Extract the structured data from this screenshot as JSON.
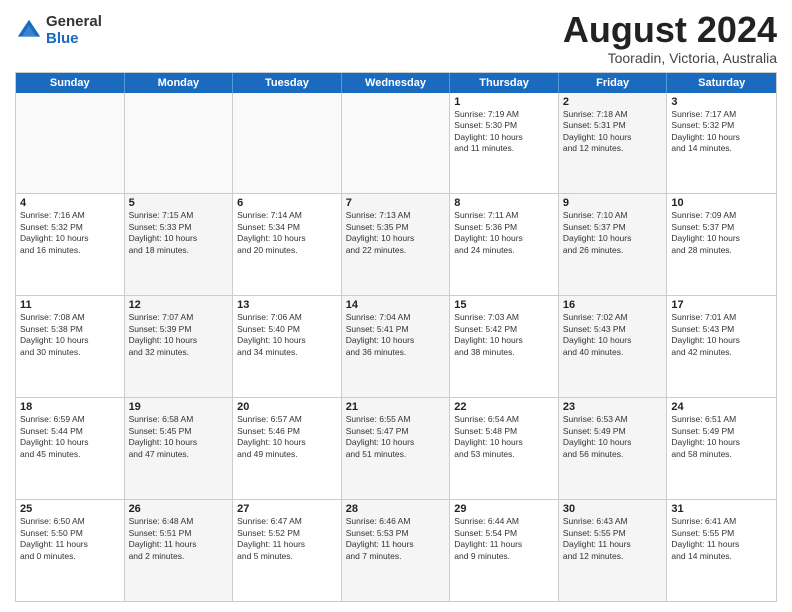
{
  "logo": {
    "general": "General",
    "blue": "Blue"
  },
  "title": "August 2024",
  "location": "Tooradin, Victoria, Australia",
  "header_days": [
    "Sunday",
    "Monday",
    "Tuesday",
    "Wednesday",
    "Thursday",
    "Friday",
    "Saturday"
  ],
  "rows": [
    [
      {
        "day": "",
        "text": "",
        "empty": true
      },
      {
        "day": "",
        "text": "",
        "empty": true
      },
      {
        "day": "",
        "text": "",
        "empty": true
      },
      {
        "day": "",
        "text": "",
        "empty": true
      },
      {
        "day": "1",
        "text": "Sunrise: 7:19 AM\nSunset: 5:30 PM\nDaylight: 10 hours\nand 11 minutes."
      },
      {
        "day": "2",
        "text": "Sunrise: 7:18 AM\nSunset: 5:31 PM\nDaylight: 10 hours\nand 12 minutes.",
        "alt": true
      },
      {
        "day": "3",
        "text": "Sunrise: 7:17 AM\nSunset: 5:32 PM\nDaylight: 10 hours\nand 14 minutes."
      }
    ],
    [
      {
        "day": "4",
        "text": "Sunrise: 7:16 AM\nSunset: 5:32 PM\nDaylight: 10 hours\nand 16 minutes."
      },
      {
        "day": "5",
        "text": "Sunrise: 7:15 AM\nSunset: 5:33 PM\nDaylight: 10 hours\nand 18 minutes.",
        "alt": true
      },
      {
        "day": "6",
        "text": "Sunrise: 7:14 AM\nSunset: 5:34 PM\nDaylight: 10 hours\nand 20 minutes."
      },
      {
        "day": "7",
        "text": "Sunrise: 7:13 AM\nSunset: 5:35 PM\nDaylight: 10 hours\nand 22 minutes.",
        "alt": true
      },
      {
        "day": "8",
        "text": "Sunrise: 7:11 AM\nSunset: 5:36 PM\nDaylight: 10 hours\nand 24 minutes."
      },
      {
        "day": "9",
        "text": "Sunrise: 7:10 AM\nSunset: 5:37 PM\nDaylight: 10 hours\nand 26 minutes.",
        "alt": true
      },
      {
        "day": "10",
        "text": "Sunrise: 7:09 AM\nSunset: 5:37 PM\nDaylight: 10 hours\nand 28 minutes."
      }
    ],
    [
      {
        "day": "11",
        "text": "Sunrise: 7:08 AM\nSunset: 5:38 PM\nDaylight: 10 hours\nand 30 minutes."
      },
      {
        "day": "12",
        "text": "Sunrise: 7:07 AM\nSunset: 5:39 PM\nDaylight: 10 hours\nand 32 minutes.",
        "alt": true
      },
      {
        "day": "13",
        "text": "Sunrise: 7:06 AM\nSunset: 5:40 PM\nDaylight: 10 hours\nand 34 minutes."
      },
      {
        "day": "14",
        "text": "Sunrise: 7:04 AM\nSunset: 5:41 PM\nDaylight: 10 hours\nand 36 minutes.",
        "alt": true
      },
      {
        "day": "15",
        "text": "Sunrise: 7:03 AM\nSunset: 5:42 PM\nDaylight: 10 hours\nand 38 minutes."
      },
      {
        "day": "16",
        "text": "Sunrise: 7:02 AM\nSunset: 5:43 PM\nDaylight: 10 hours\nand 40 minutes.",
        "alt": true
      },
      {
        "day": "17",
        "text": "Sunrise: 7:01 AM\nSunset: 5:43 PM\nDaylight: 10 hours\nand 42 minutes."
      }
    ],
    [
      {
        "day": "18",
        "text": "Sunrise: 6:59 AM\nSunset: 5:44 PM\nDaylight: 10 hours\nand 45 minutes."
      },
      {
        "day": "19",
        "text": "Sunrise: 6:58 AM\nSunset: 5:45 PM\nDaylight: 10 hours\nand 47 minutes.",
        "alt": true
      },
      {
        "day": "20",
        "text": "Sunrise: 6:57 AM\nSunset: 5:46 PM\nDaylight: 10 hours\nand 49 minutes."
      },
      {
        "day": "21",
        "text": "Sunrise: 6:55 AM\nSunset: 5:47 PM\nDaylight: 10 hours\nand 51 minutes.",
        "alt": true
      },
      {
        "day": "22",
        "text": "Sunrise: 6:54 AM\nSunset: 5:48 PM\nDaylight: 10 hours\nand 53 minutes."
      },
      {
        "day": "23",
        "text": "Sunrise: 6:53 AM\nSunset: 5:49 PM\nDaylight: 10 hours\nand 56 minutes.",
        "alt": true
      },
      {
        "day": "24",
        "text": "Sunrise: 6:51 AM\nSunset: 5:49 PM\nDaylight: 10 hours\nand 58 minutes."
      }
    ],
    [
      {
        "day": "25",
        "text": "Sunrise: 6:50 AM\nSunset: 5:50 PM\nDaylight: 11 hours\nand 0 minutes."
      },
      {
        "day": "26",
        "text": "Sunrise: 6:48 AM\nSunset: 5:51 PM\nDaylight: 11 hours\nand 2 minutes.",
        "alt": true
      },
      {
        "day": "27",
        "text": "Sunrise: 6:47 AM\nSunset: 5:52 PM\nDaylight: 11 hours\nand 5 minutes."
      },
      {
        "day": "28",
        "text": "Sunrise: 6:46 AM\nSunset: 5:53 PM\nDaylight: 11 hours\nand 7 minutes.",
        "alt": true
      },
      {
        "day": "29",
        "text": "Sunrise: 6:44 AM\nSunset: 5:54 PM\nDaylight: 11 hours\nand 9 minutes."
      },
      {
        "day": "30",
        "text": "Sunrise: 6:43 AM\nSunset: 5:55 PM\nDaylight: 11 hours\nand 12 minutes.",
        "alt": true
      },
      {
        "day": "31",
        "text": "Sunrise: 6:41 AM\nSunset: 5:55 PM\nDaylight: 11 hours\nand 14 minutes."
      }
    ]
  ]
}
